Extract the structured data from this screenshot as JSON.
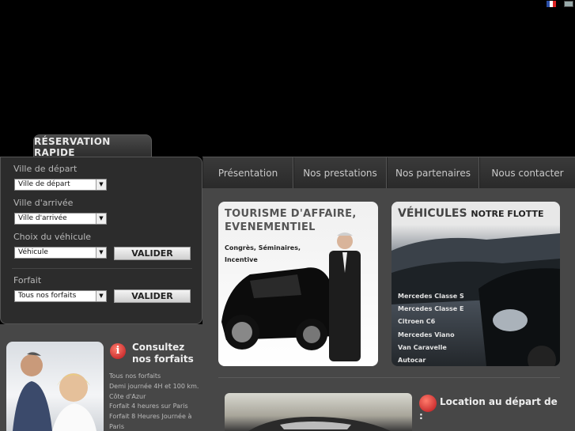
{
  "reservation": {
    "tab_label": "RÉSERVATION RAPIDE",
    "depart_label": "Ville de départ",
    "depart_value": "Ville de départ",
    "arrivee_label": "Ville d'arrivée",
    "arrivee_value": "Ville d'arrivée",
    "vehicule_label": "Choix du véhicule",
    "vehicule_value": "Véhicule",
    "valider_1": "VALIDER",
    "forfait_label": "Forfait",
    "forfait_value": "Tous nos forfaits",
    "valider_2": "VALIDER"
  },
  "nav": {
    "items": [
      "Présentation",
      "Nos prestations",
      "Nos partenaires",
      "Nous contacter"
    ]
  },
  "tourisme": {
    "title_line1": "TOURISME D'AFFAIRE,",
    "title_line2": "EVENEMENTIEL",
    "sub_line1": "Congrès, Séminaires,",
    "sub_line2": "Incentive"
  },
  "vehicules": {
    "title": "VÉHICULES",
    "title_small": "NOTRE FLOTTE",
    "list": [
      "Mercedes Classe S",
      "Mercedes Classe E",
      "Citroen C6",
      "Mercedes Viano",
      "Van Caravelle",
      "Autocar"
    ]
  },
  "forfaits": {
    "icon": "i",
    "title_line1": "Consultez",
    "title_line2": "nos forfaits",
    "list": [
      "Tous nos forfaits",
      "Demi journée 4H et 100 km.",
      "Côte d'Azur",
      "Forfait 4 heures sur Paris",
      "Forfait 8 Heures Journée à",
      "Paris"
    ]
  },
  "location": {
    "title_line1": "Location au départ de",
    "title_line2": ":"
  }
}
